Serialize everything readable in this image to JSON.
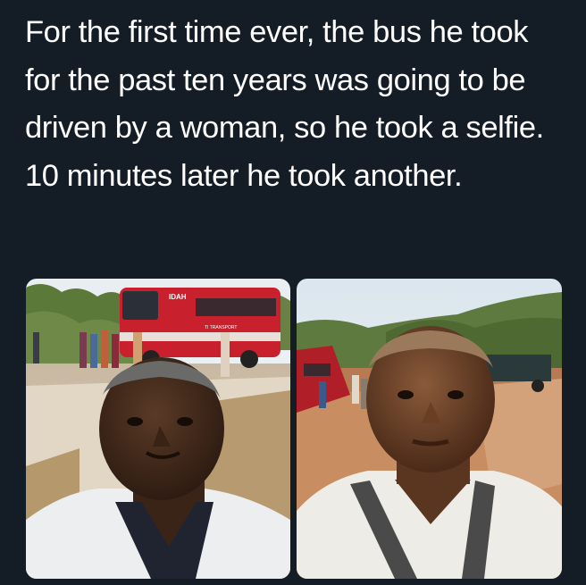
{
  "post": {
    "caption": "For the first time ever, the bus he took for the past ten years was going to be driven by a woman, so he took a selfie. 10 minutes later he took another."
  },
  "photos": {
    "left": {
      "sign_text": "IDAH",
      "bus_side_text": "TI TRANSPORT"
    },
    "right": {}
  },
  "colors": {
    "background": "#141d26",
    "caption_text": "#ffffff",
    "bus_red": "#c8202c"
  }
}
